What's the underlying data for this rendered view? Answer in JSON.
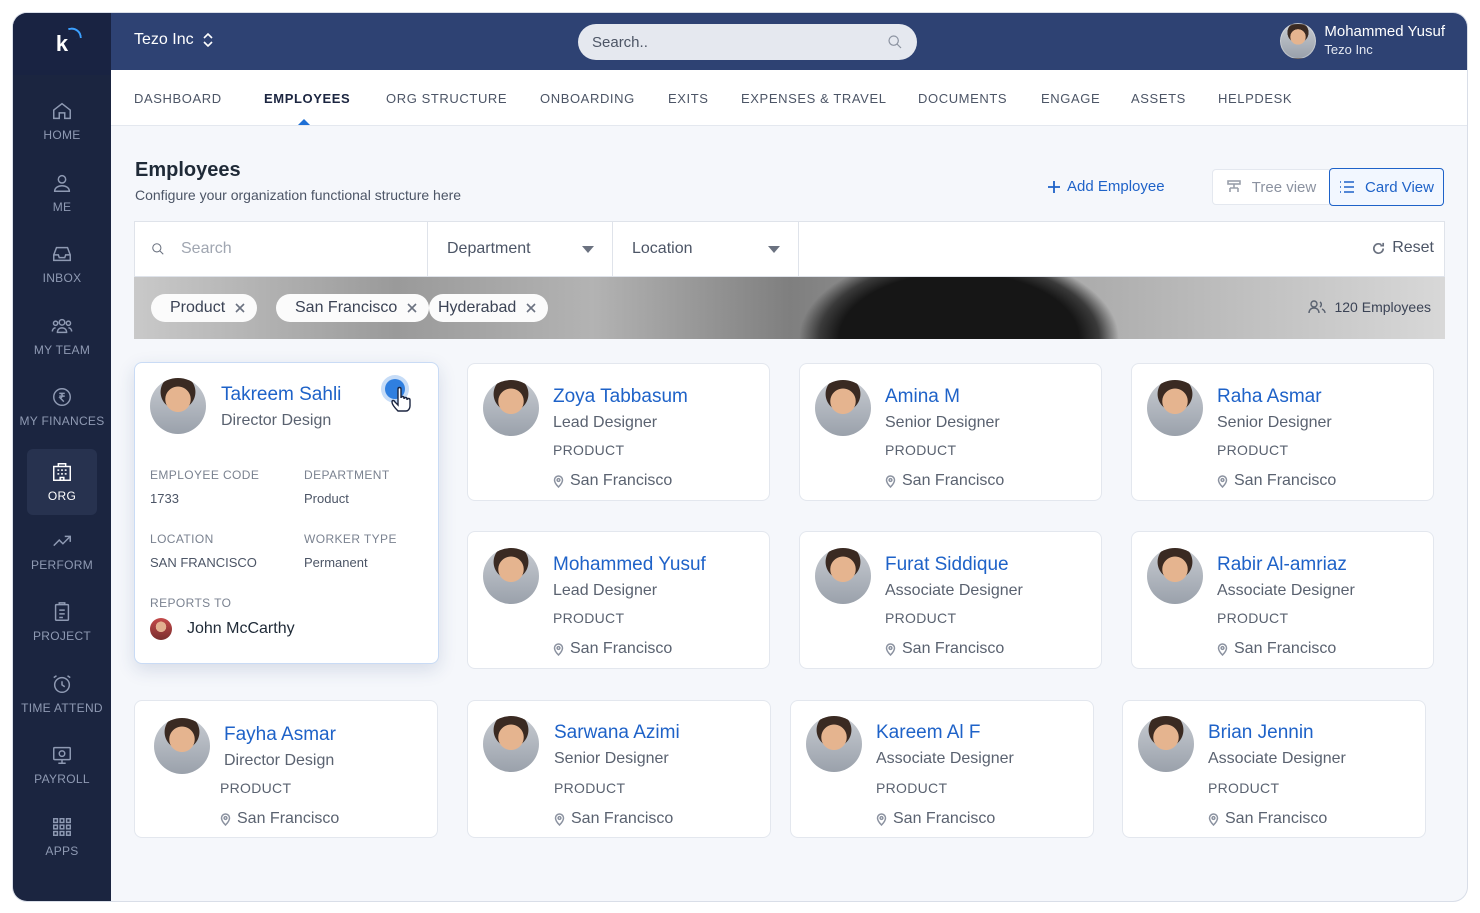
{
  "app": {
    "org_name": "Tezo Inc",
    "search_placeholder": "Search..",
    "user": {
      "name": "Mohammed Yusuf",
      "org": "Tezo Inc"
    }
  },
  "sidebar": {
    "items": [
      {
        "label": "HOME",
        "icon": "home-icon"
      },
      {
        "label": "ME",
        "icon": "user-icon"
      },
      {
        "label": "INBOX",
        "icon": "inbox-icon"
      },
      {
        "label": "MY TEAM",
        "icon": "team-icon"
      },
      {
        "label": "MY FINANCES",
        "icon": "rupee-icon"
      },
      {
        "label": "ORG",
        "icon": "building-icon",
        "active": true
      },
      {
        "label": "PERFORM",
        "icon": "trend-icon"
      },
      {
        "label": "PROJECT",
        "icon": "clipboard-icon"
      },
      {
        "label": "TIME ATTEND",
        "icon": "alarm-icon"
      },
      {
        "label": "PAYROLL",
        "icon": "payroll-icon"
      },
      {
        "label": "APPS",
        "icon": "grid-icon"
      }
    ]
  },
  "tabs": [
    "DASHBOARD",
    "EMPLOYEES",
    "ORG STRUCTURE",
    "ONBOARDING",
    "EXITS",
    "EXPENSES & TRAVEL",
    "DOCUMENTS",
    "ENGAGE",
    "ASSETS",
    "HELPDESK"
  ],
  "active_tab": "EMPLOYEES",
  "page": {
    "title": "Employees",
    "subtitle": "Configure your organization functional structure here",
    "add_label": "Add Employee",
    "tree_view_label": "Tree view",
    "card_view_label": "Card View"
  },
  "filters": {
    "search_placeholder": "Search",
    "department_label": "Department",
    "location_label": "Location",
    "reset_label": "Reset",
    "chips": [
      "Product",
      "San Francisco",
      "Hyderabad"
    ],
    "count_label": "120 Employees"
  },
  "expanded": {
    "name": "Takreem Sahli",
    "role": "Director Design",
    "code_label": "EMPLOYEE CODE",
    "code": "1733",
    "dept_label": "DEPARTMENT",
    "dept": "Product",
    "loc_label": "LOCATION",
    "loc": "SAN FRANCISCO",
    "worker_label": "WORKER TYPE",
    "worker": "Permanent",
    "reports_label": "REPORTS TO",
    "reports": "John McCarthy"
  },
  "employees": [
    {
      "name": "Zoya Tabbasum",
      "role": "Lead Designer",
      "dept": "PRODUCT",
      "loc": "San Francisco"
    },
    {
      "name": "Amina M",
      "role": "Senior Designer",
      "dept": "PRODUCT",
      "loc": "San Francisco"
    },
    {
      "name": "Raha Asmar",
      "role": "Senior Designer",
      "dept": "PRODUCT",
      "loc": "San Francisco"
    },
    {
      "name": "Mohammed Yusuf",
      "role": "Lead Designer",
      "dept": "PRODUCT",
      "loc": "San Francisco"
    },
    {
      "name": "Furat Siddique",
      "role": "Associate Designer",
      "dept": "PRODUCT",
      "loc": "San Francisco"
    },
    {
      "name": "Rabir Al-amriaz",
      "role": "Associate Designer",
      "dept": "PRODUCT",
      "loc": "San Francisco"
    },
    {
      "name": "Fayha Asmar",
      "role": "Director Design",
      "dept": "PRODUCT",
      "loc": "San Francisco"
    },
    {
      "name": "Sarwana Azimi",
      "role": "Senior Designer",
      "dept": "PRODUCT",
      "loc": "San Francisco"
    },
    {
      "name": "Kareem Al F",
      "role": "Associate Designer",
      "dept": "PRODUCT",
      "loc": "San Francisco"
    },
    {
      "name": "Brian Jennin",
      "role": "Associate Designer",
      "dept": "PRODUCT",
      "loc": "San Francisco"
    }
  ]
}
